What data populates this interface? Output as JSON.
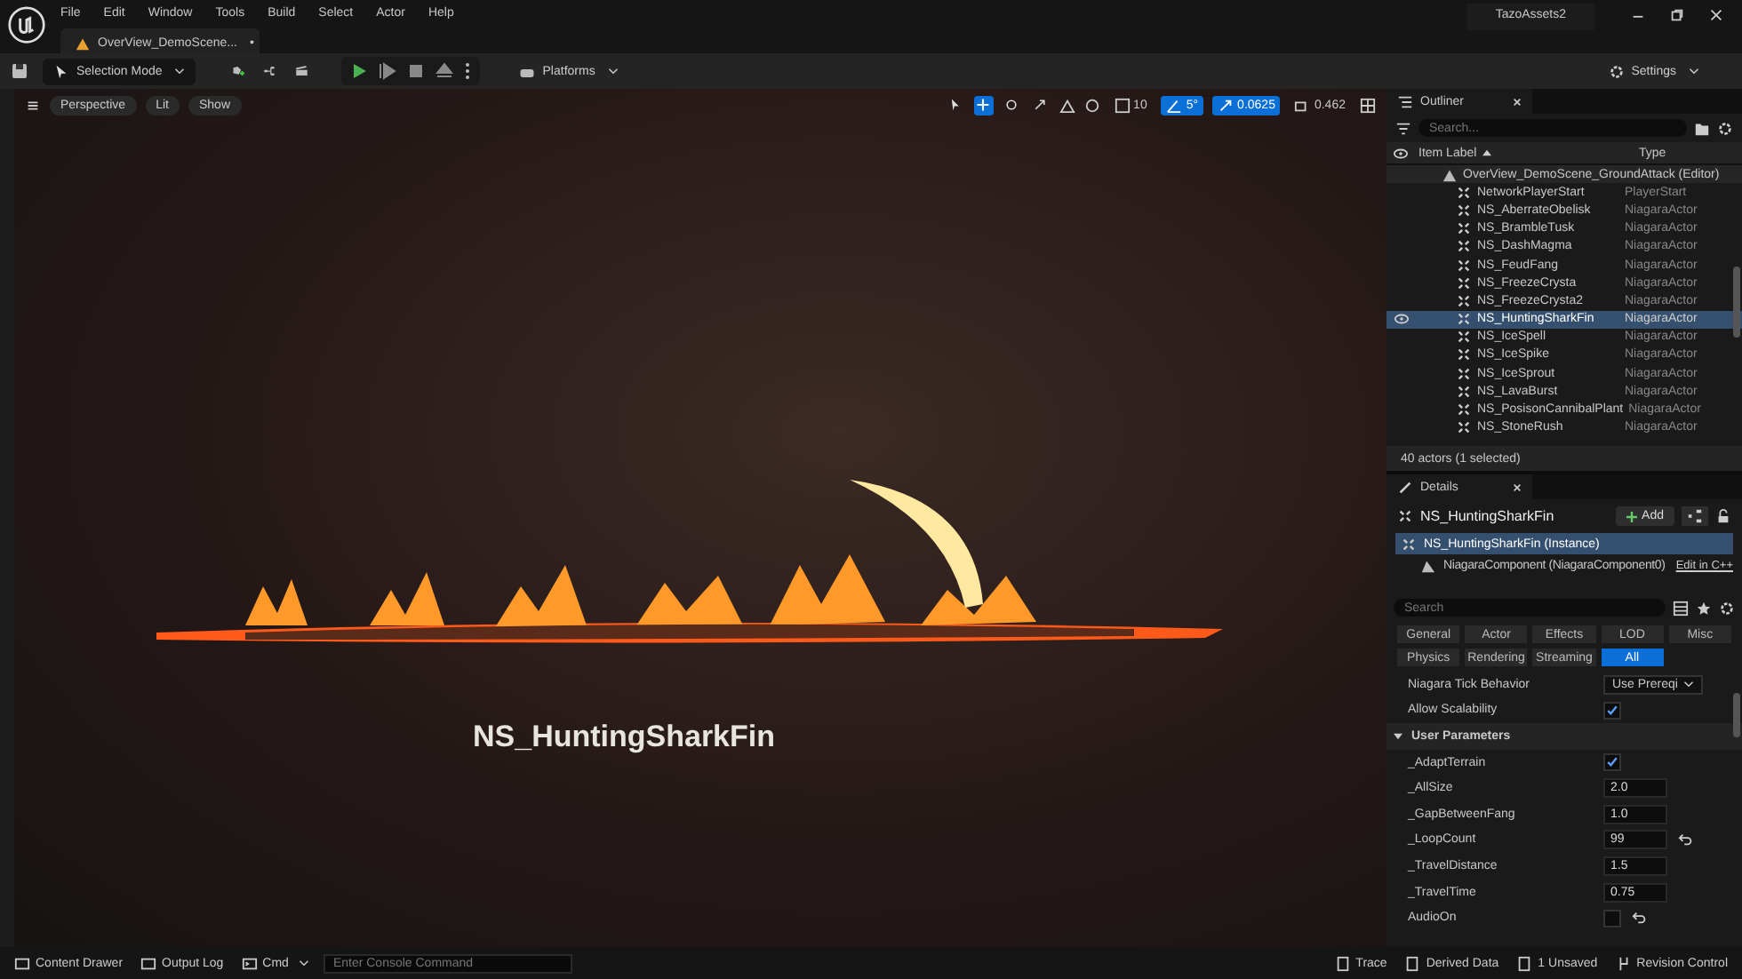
{
  "app_menu": [
    "File",
    "Edit",
    "Window",
    "Tools",
    "Build",
    "Select",
    "Actor",
    "Help"
  ],
  "project_name": "TazoAssets2",
  "level_tab": {
    "label": "OverView_DemoScene...",
    "modified_mark": "•"
  },
  "toolbar": {
    "mode": "Selection Mode",
    "platforms": "Platforms",
    "settings": "Settings"
  },
  "viewport": {
    "view_buttons": [
      "Perspective",
      "Lit",
      "Show"
    ],
    "transform_tools": [
      {
        "selected": false
      },
      {
        "selected": true
      },
      {
        "selected": false
      },
      {
        "selected": false
      }
    ],
    "snaps": [
      {
        "value": "10",
        "selected": false
      },
      {
        "value": "5°",
        "selected": true
      },
      {
        "value": "0.0625",
        "selected": true
      },
      {
        "value": "0.462",
        "selected": false
      }
    ],
    "scene_label": "NS_HuntingSharkFin"
  },
  "outliner": {
    "title": "Outliner",
    "search_placeholder": "Search...",
    "columns": [
      "Item Label",
      "Type"
    ],
    "tree": [
      {
        "label": "OverView_DemoScene_GroundAttack (Editor)",
        "selected": false,
        "children": [
          {
            "label": "NetworkPlayerStart",
            "type": "PlayerStart",
            "selected": false
          },
          {
            "label": "NS_AberrateObelisk",
            "type": "NiagaraActor",
            "selected": false
          },
          {
            "label": "NS_BrambleTusk",
            "type": "NiagaraActor",
            "selected": false
          },
          {
            "label": "NS_DashMagma",
            "type": "NiagaraActor",
            "selected": false
          },
          {
            "label": "NS_FeudFang",
            "type": "NiagaraActor",
            "selected": false
          },
          {
            "label": "NS_FreezeCrysta",
            "type": "NiagaraActor",
            "selected": false
          },
          {
            "label": "NS_FreezeCrysta2",
            "type": "NiagaraActor",
            "selected": false
          },
          {
            "label": "NS_HuntingSharkFin",
            "type": "NiagaraActor",
            "selected": true
          },
          {
            "label": "NS_IceSpell",
            "type": "NiagaraActor",
            "selected": false
          },
          {
            "label": "NS_IceSpike",
            "type": "NiagaraActor",
            "selected": false
          },
          {
            "label": "NS_IceSprout",
            "type": "NiagaraActor",
            "selected": false
          },
          {
            "label": "NS_LavaBurst",
            "type": "NiagaraActor",
            "selected": false
          },
          {
            "label": "NS_PosisonCannibalPlant",
            "type": "NiagaraActor",
            "selected": false
          },
          {
            "label": "NS_StoneRush",
            "type": "NiagaraActor",
            "selected": false
          }
        ]
      }
    ],
    "footer": "40 actors (1 selected)"
  },
  "details": {
    "title": "Details",
    "actor_name": "NS_HuntingSharkFin",
    "add_button": "Add",
    "components": [
      {
        "label": "NS_HuntingSharkFin (Instance)",
        "selected": true,
        "children": [
          {
            "label": "NiagaraComponent (NiagaraComponent0)",
            "selected": false
          }
        ]
      }
    ],
    "edit_link": "Edit in C++",
    "search_placeholder": "Search",
    "filters": [
      {
        "label": "General",
        "selected": false
      },
      {
        "label": "Actor",
        "selected": false
      },
      {
        "label": "Effects",
        "selected": false
      },
      {
        "label": "LOD",
        "selected": false
      },
      {
        "label": "Misc",
        "selected": false
      },
      {
        "label": "Physics",
        "selected": false
      },
      {
        "label": "Rendering",
        "selected": false
      },
      {
        "label": "Streaming",
        "selected": false
      },
      {
        "label": "All",
        "selected": true
      }
    ],
    "properties": [
      {
        "kind": "dropdown",
        "label": "Niagara Tick Behavior",
        "value": "Use Prereqi"
      },
      {
        "kind": "checkbox",
        "label": "Allow Scalability",
        "checked": true
      },
      {
        "kind": "section",
        "label": "User Parameters",
        "expanded": true
      },
      {
        "kind": "checkbox",
        "label": "_AdaptTerrain",
        "checked": true
      },
      {
        "kind": "number",
        "label": "_AllSize",
        "value": "2.0"
      },
      {
        "kind": "number",
        "label": "_GapBetweenFang",
        "value": "1.0"
      },
      {
        "kind": "number",
        "label": "_LoopCount",
        "value": "99",
        "resettable": true
      },
      {
        "kind": "number",
        "label": "_TravelDistance",
        "value": "1.5"
      },
      {
        "kind": "number",
        "label": "_TravelTime",
        "value": "0.75"
      },
      {
        "kind": "checkbox",
        "label": "AudioOn",
        "checked": false,
        "resettable": true
      }
    ]
  },
  "status_bar": {
    "left": [
      "Content Drawer",
      "Output Log"
    ],
    "cmd": "Cmd",
    "console_placeholder": "Enter Console Command",
    "right": [
      "Trace",
      "Derived Data",
      "1 Unsaved",
      "Revision Control"
    ]
  }
}
